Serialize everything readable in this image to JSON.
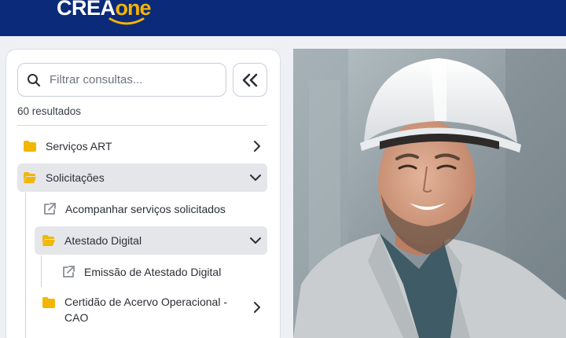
{
  "header": {
    "logo_crea": "CREA",
    "logo_one": "one"
  },
  "sidebar": {
    "search_placeholder": "Filtrar consultas...",
    "search_value": "",
    "collapse_icon": "double-chevron-left-icon",
    "results_text": "60 resultados",
    "items": [
      {
        "label": "Serviços ART",
        "icon": "folder-icon",
        "state": "collapsed"
      },
      {
        "label": "Solicitações",
        "icon": "folder-open-icon",
        "state": "expanded"
      },
      {
        "label": "Acompanhar serviços solicitados",
        "icon": "external-link-icon"
      },
      {
        "label": "Atestado Digital",
        "icon": "folder-open-icon",
        "state": "expanded"
      },
      {
        "label": "Emissão de Atestado Digital",
        "icon": "external-link-icon"
      },
      {
        "label_line1": "Certidão de Acervo Operacional -",
        "label_line2": "CAO",
        "icon": "folder-icon",
        "state": "collapsed"
      }
    ]
  },
  "colors": {
    "header_bg": "#0b2a7a",
    "brand_yellow": "#f5b400",
    "folder": "#f2b705",
    "active_row": "#e4e6ea"
  },
  "hero": {
    "image_subject": "smiling engineer in white hard hat"
  }
}
